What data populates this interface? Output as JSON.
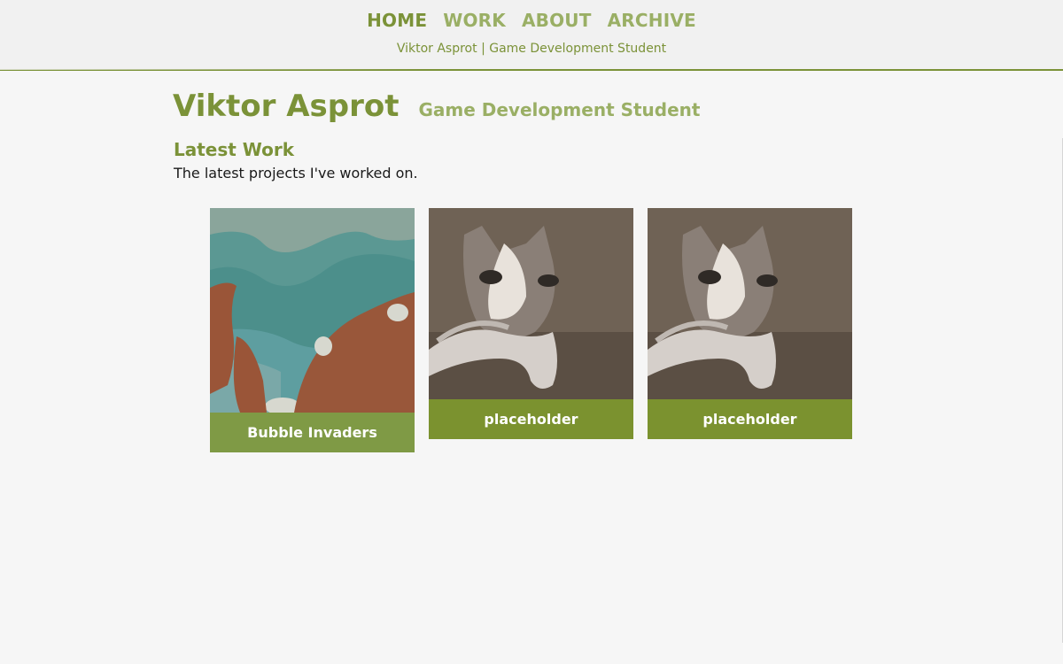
{
  "nav": {
    "items": [
      {
        "label": "HOME",
        "active": true
      },
      {
        "label": "WORK",
        "active": false
      },
      {
        "label": "ABOUT",
        "active": false
      },
      {
        "label": "ARCHIVE",
        "active": false
      }
    ],
    "tagline": "Viktor Asprot | Game Development Student"
  },
  "header": {
    "name": "Viktor Asprot",
    "role": "Game Development Student"
  },
  "latest": {
    "title": "Latest Work",
    "description": "The latest projects I've worked on."
  },
  "projects": [
    {
      "title": "Bubble Invaders",
      "image": "game-scene-thumbnail",
      "label_color": "#7f9a45"
    },
    {
      "title": "placeholder",
      "image": "cat-photo-thumbnail",
      "label_color": "#7b922f"
    },
    {
      "title": "placeholder",
      "image": "cat-photo-thumbnail",
      "label_color": "#7b922f"
    }
  ],
  "colors": {
    "accent": "#7b9238",
    "accent_light": "#9aaf65",
    "background": "#f6f6f6"
  }
}
